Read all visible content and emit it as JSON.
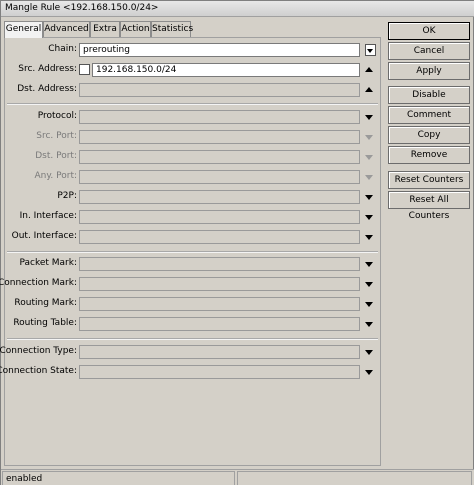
{
  "window": {
    "title": "Mangle Rule <192.168.150.0/24>"
  },
  "tabs": [
    "General",
    "Advanced",
    "Extra",
    "Action",
    "Statistics"
  ],
  "form": {
    "chain": {
      "label": "Chain:",
      "value": "prerouting"
    },
    "src_address": {
      "label": "Src. Address:",
      "value": "192.168.150.0/24"
    },
    "dst_address": {
      "label": "Dst. Address:"
    },
    "protocol": {
      "label": "Protocol:"
    },
    "src_port": {
      "label": "Src. Port:"
    },
    "dst_port": {
      "label": "Dst. Port:"
    },
    "any_port": {
      "label": "Any. Port:"
    },
    "p2p": {
      "label": "P2P:"
    },
    "in_interface": {
      "label": "In. Interface:"
    },
    "out_interface": {
      "label": "Out. Interface:"
    },
    "packet_mark": {
      "label": "Packet Mark:"
    },
    "connection_mark": {
      "label": "Connection Mark:"
    },
    "routing_mark": {
      "label": "Routing Mark:"
    },
    "routing_table": {
      "label": "Routing Table:"
    },
    "connection_type": {
      "label": "Connection Type:"
    },
    "connection_state": {
      "label": "Connection State:"
    }
  },
  "buttons": {
    "ok": "OK",
    "cancel": "Cancel",
    "apply": "Apply",
    "disable": "Disable",
    "comment": "Comment",
    "copy": "Copy",
    "remove": "Remove",
    "reset_counters": "Reset Counters",
    "reset_all_counters": "Reset All Counters"
  },
  "status": {
    "text": "enabled"
  },
  "icons": {
    "dropdown": "triangle-down-icon",
    "expand": "triangle-up-icon",
    "select": "select-arrow-icon"
  }
}
